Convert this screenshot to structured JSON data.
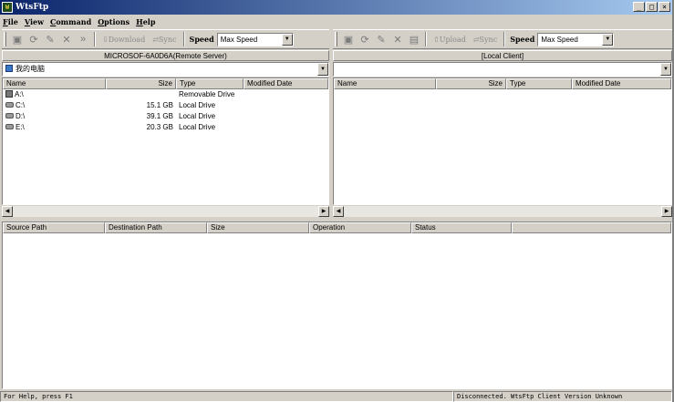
{
  "window": {
    "title": "WtsFtp",
    "app_icon": "W"
  },
  "window_buttons": {
    "minimize": "_",
    "maximize": "□",
    "close": "×"
  },
  "menu": [
    "File",
    "View",
    "Command",
    "Options",
    "Help"
  ],
  "left_toolbar": {
    "download_label": "Download",
    "sync_label": "Sync",
    "speed_label": "Speed",
    "speed_value": "Max Speed"
  },
  "right_toolbar": {
    "upload_label": "Upload",
    "sync_label": "Sync",
    "speed_label": "Speed",
    "speed_value": "Max Speed"
  },
  "remote": {
    "title": "MICROSOF-6A0D6A(Remote Server)",
    "address": "我的电脑",
    "columns": [
      "Name",
      "Size",
      "Type",
      "Modified Date"
    ],
    "rows": [
      {
        "name": "A:\\",
        "size": "",
        "type": "Removable Drive",
        "icon": "floppy-icon"
      },
      {
        "name": "C:\\",
        "size": "15.1 GB",
        "type": "Local Drive",
        "icon": "hard-drive-icon"
      },
      {
        "name": "D:\\",
        "size": "39.1 GB",
        "type": "Local Drive",
        "icon": "hard-drive-icon"
      },
      {
        "name": "E:\\",
        "size": "20.3 GB",
        "type": "Local Drive",
        "icon": "hard-drive-icon"
      }
    ]
  },
  "local": {
    "title": "[Local Client]",
    "address": "",
    "columns": [
      "Name",
      "Size",
      "Type",
      "Modified Date"
    ]
  },
  "queue": {
    "columns": [
      "Source Path",
      "Destination Path",
      "Size",
      "Operation",
      "Status"
    ]
  },
  "status": {
    "left": "For Help, press F1",
    "right": "Disconnected. WtsFtp Client Version Unknown"
  },
  "icons": {
    "arrow_left": "◀",
    "arrow_right": "▶",
    "arrow_down": "▼"
  }
}
